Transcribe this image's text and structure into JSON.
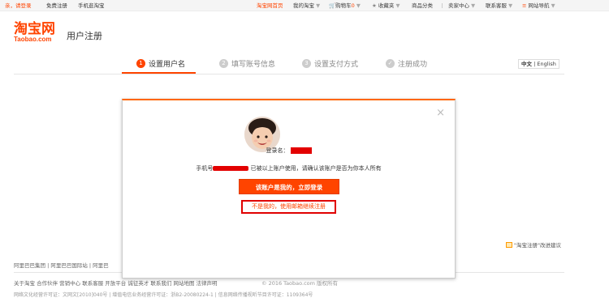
{
  "topbar": {
    "greeting": "亲，请登录",
    "register": "免费注册",
    "mobile": "手机逛淘宝",
    "home": "淘宝网首页",
    "my_taobao": "我的淘宝",
    "cart": "购物车",
    "cart_count": "0",
    "favorites": "收藏夹",
    "categories": "商品分类",
    "seller_center": "卖家中心",
    "contact": "联系客服",
    "site_nav": "网站导航"
  },
  "header": {
    "logo_cn": "淘宝网",
    "logo_en": "Taobao.com",
    "title": "用户注册"
  },
  "steps": [
    {
      "num": "1",
      "label": "设置用户名"
    },
    {
      "num": "2",
      "label": "填写账号信息"
    },
    {
      "num": "3",
      "label": "设置支付方式"
    },
    {
      "num": "✓",
      "label": "注册成功"
    }
  ],
  "lang": {
    "zh": "中文",
    "sep": "|",
    "en": "English"
  },
  "feedback": {
    "label": "\"淘宝注册\"改进建议"
  },
  "modal": {
    "close": "×",
    "login_label": "登录名：",
    "phone_label": "手机号",
    "phone_msg": "已被以上账户使用，请确认该账户是否为你本人所有",
    "primary_button": "该账户是我的，立即登录",
    "alt_button": "不是我的，使用邮箱继续注册"
  },
  "footer": {
    "links1": "阿里巴巴集团  |  阿里巴巴国际站  |  阿里巴",
    "links2": "关于淘宝  合作伙伴  营销中心  联系客服  开放平台  诚征英才  联系我们  网站地图  法律声明",
    "copyright": "© 2016 Taobao.com 版权所有",
    "license": "网络文化经营许可证：文网文[2010]040号  |  增值电信业务经营许可证：浙B2-20080224-1  |  信息网络传播视听节目许可证：1109364号"
  }
}
